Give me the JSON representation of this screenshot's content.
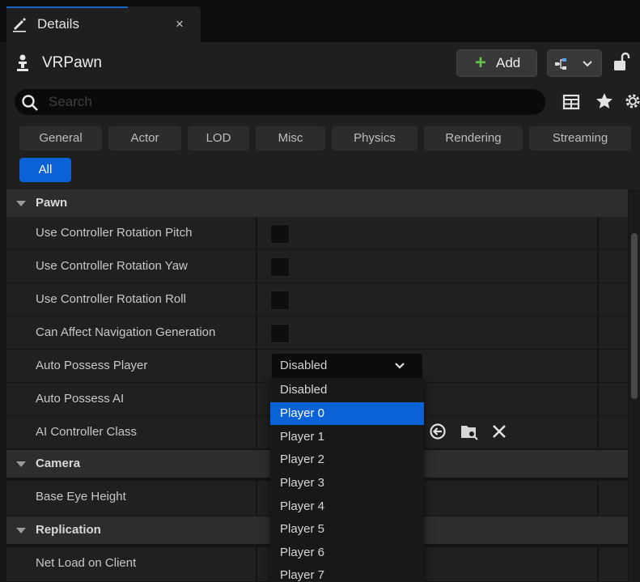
{
  "tab": {
    "title": "Details",
    "close": "×"
  },
  "header": {
    "actor_name": "VRPawn",
    "add_label": "Add",
    "add_plus": "+"
  },
  "search": {
    "placeholder": "Search"
  },
  "filters": [
    "General",
    "Actor",
    "LOD",
    "Misc",
    "Physics",
    "Rendering",
    "Streaming",
    "All"
  ],
  "active_filter": "All",
  "sections": {
    "pawn": "Pawn",
    "camera": "Camera",
    "replication": "Replication"
  },
  "properties": {
    "pitch": "Use Controller Rotation Pitch",
    "yaw": "Use Controller Rotation Yaw",
    "roll": "Use Controller Rotation Roll",
    "nav": "Can Affect Navigation Generation",
    "auto_player": "Auto Possess Player",
    "auto_ai": "Auto Possess AI",
    "ai_class": "AI Controller Class",
    "eye_height": "Base Eye Height",
    "net_load": "Net Load on Client"
  },
  "checkboxes": {
    "pitch": false,
    "yaw": false,
    "roll": false,
    "nav": false
  },
  "auto_possess_player": {
    "value": "Disabled",
    "options": [
      "Disabled",
      "Player 0",
      "Player 1",
      "Player 2",
      "Player 3",
      "Player 4",
      "Player 5",
      "Player 6",
      "Player 7"
    ],
    "highlighted": "Player 0"
  },
  "colors": {
    "accent": "#0a62d6",
    "add_green": "#63c44c",
    "panel": "#1f1f1f",
    "row": "#202020",
    "section": "#2d2d2d"
  },
  "icons": [
    "pencil-icon",
    "close-icon",
    "pawn-icon",
    "plus-icon",
    "blueprint-icon",
    "lock-icon",
    "search-icon",
    "table-icon",
    "star-icon",
    "gear-icon",
    "chevron-down-icon",
    "use-selected-icon",
    "browse-icon",
    "clear-icon"
  ]
}
